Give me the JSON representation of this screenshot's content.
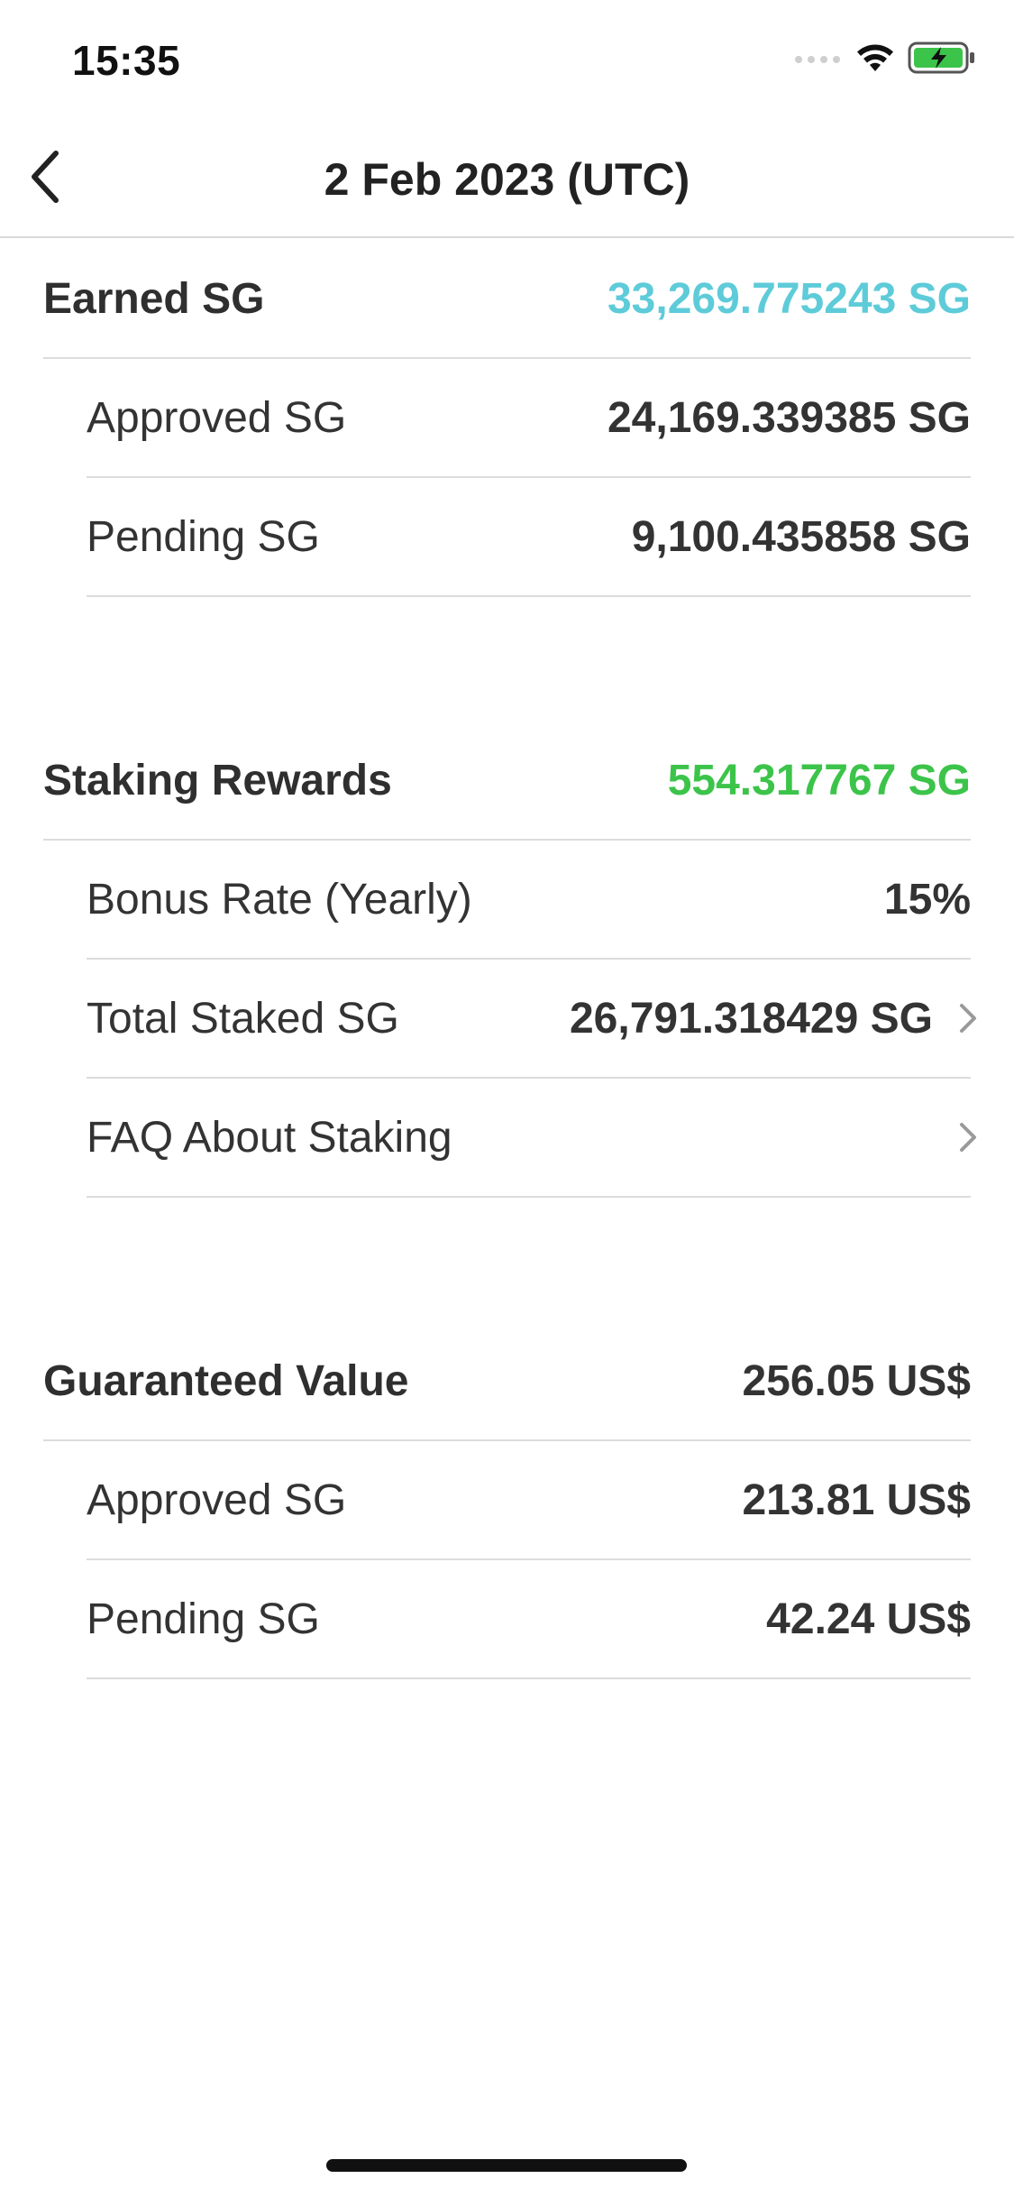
{
  "status_bar": {
    "time": "15:35",
    "battery_color": "#3cc44a"
  },
  "nav": {
    "title": "2 Feb 2023 (UTC)",
    "back_icon": "chevron-left-icon"
  },
  "earned": {
    "label": "Earned SG",
    "value": "33,269.775243 SG",
    "value_color": "#5ecbd9",
    "items": [
      {
        "label": "Approved SG",
        "value": "24,169.339385 SG"
      },
      {
        "label": "Pending SG",
        "value": "9,100.435858 SG"
      }
    ]
  },
  "staking": {
    "label": "Staking Rewards",
    "value": "554.317767 SG",
    "value_color": "#3cc44a",
    "items": [
      {
        "label": "Bonus Rate (Yearly)",
        "value": "15%"
      },
      {
        "label": "Total Staked SG",
        "value": "26,791.318429 SG",
        "icon": "chevron-right-icon"
      },
      {
        "label": "FAQ About Staking",
        "value": "",
        "icon": "chevron-right-icon"
      }
    ]
  },
  "guaranteed": {
    "label": "Guaranteed Value",
    "value": "256.05 US$",
    "items": [
      {
        "label": "Approved SG",
        "value": "213.81 US$"
      },
      {
        "label": "Pending SG",
        "value": "42.24 US$"
      }
    ]
  }
}
